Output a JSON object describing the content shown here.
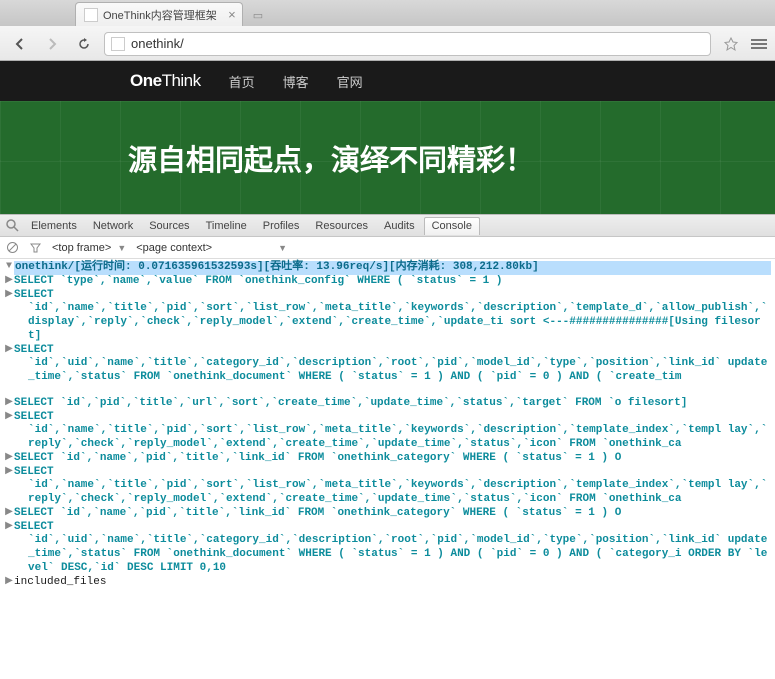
{
  "window": {
    "tab_title": "OneThink内容管理框架",
    "address": "onethink/"
  },
  "page": {
    "logo_bold": "One",
    "logo_thin": "Think",
    "nav": [
      "首页",
      "博客",
      "官网"
    ],
    "hero": "源自相同起点，演绎不同精彩！"
  },
  "devtools": {
    "tabs": [
      "Elements",
      "Network",
      "Sources",
      "Timeline",
      "Profiles",
      "Resources",
      "Audits",
      "Console"
    ],
    "active_tab": "Console",
    "frame_selector": "<top frame>",
    "context_selector": "<page context>"
  },
  "console_log": [
    {
      "t": "top",
      "text": "onethink/[运行时间: 0.071635961532593s][吞吐率: 13.96req/s][内存消耗: 308,212.80kb]"
    },
    {
      "t": "l1",
      "text": "SELECT `type`,`name`,`value` FROM `onethink_config` WHERE ( `status` = 1 )"
    },
    {
      "t": "l1",
      "text": "SELECT"
    },
    {
      "t": "l2",
      "text": "`id`,`name`,`title`,`pid`,`sort`,`list_row`,`meta_title`,`keywords`,`description`,`template_d`,`allow_publish`,`display`,`reply`,`check`,`reply_model`,`extend`,`create_time`,`update_ti sort   <---###############[Using filesort]"
    },
    {
      "t": "l1",
      "text": "SELECT"
    },
    {
      "t": "l2",
      "text": "`id`,`uid`,`name`,`title`,`category_id`,`description`,`root`,`pid`,`model_id`,`type`,`position`,`link_id` update_time`,`status` FROM `onethink_document` WHERE ( `status` = 1 ) AND ( `pid` = 0 ) AND ( `create_tim"
    },
    {
      "t": "spacer",
      "text": ""
    },
    {
      "t": "l1",
      "text": "SELECT `id`,`pid`,`title`,`url`,`sort`,`create_time`,`update_time`,`status`,`target` FROM `o filesort]"
    },
    {
      "t": "l1",
      "text": "SELECT"
    },
    {
      "t": "l2",
      "text": "`id`,`name`,`title`,`pid`,`sort`,`list_row`,`meta_title`,`keywords`,`description`,`template_index`,`templ lay`,`reply`,`check`,`reply_model`,`extend`,`create_time`,`update_time`,`status`,`icon` FROM `onethink_ca"
    },
    {
      "t": "l1",
      "text": "SELECT `id`,`name`,`pid`,`title`,`link_id` FROM `onethink_category` WHERE ( `status` = 1 ) O"
    },
    {
      "t": "l1",
      "text": "SELECT"
    },
    {
      "t": "l2",
      "text": "`id`,`name`,`title`,`pid`,`sort`,`list_row`,`meta_title`,`keywords`,`description`,`template_index`,`templ lay`,`reply`,`check`,`reply_model`,`extend`,`create_time`,`update_time`,`status`,`icon` FROM `onethink_ca"
    },
    {
      "t": "l1",
      "text": "SELECT `id`,`name`,`pid`,`title`,`link_id` FROM `onethink_category` WHERE ( `status` = 1 ) O"
    },
    {
      "t": "l1",
      "text": "SELECT"
    },
    {
      "t": "l2",
      "text": "`id`,`uid`,`name`,`title`,`category_id`,`description`,`root`,`pid`,`model_id`,`type`,`position`,`link_id` update_time`,`status` FROM `onethink_document` WHERE ( `status` = 1 ) AND ( `pid` = 0 ) AND ( `category_i ORDER BY `level` DESC,`id` DESC LIMIT 0,10"
    },
    {
      "t": "l1b",
      "text": "included_files"
    }
  ]
}
